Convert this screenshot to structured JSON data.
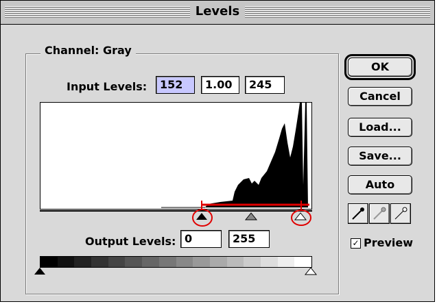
{
  "window": {
    "title": "Levels"
  },
  "channel": {
    "label": "Channel:",
    "value": "Gray"
  },
  "input_levels": {
    "label": "Input Levels:",
    "black": "152",
    "gamma": "1.00",
    "white": "245"
  },
  "output_levels": {
    "label": "Output Levels:",
    "black": "0",
    "white": "255"
  },
  "buttons": {
    "ok": "OK",
    "cancel": "Cancel",
    "load": "Load...",
    "save": "Save...",
    "auto": "Auto"
  },
  "preview": {
    "label": "Preview",
    "checked": true
  },
  "eyedroppers": [
    "black-point-eyedropper-icon",
    "gray-point-eyedropper-icon",
    "white-point-eyedropper-icon"
  ],
  "annotation": {
    "color": "#e00000"
  },
  "histogram_levels": {
    "min": 0,
    "max": 255,
    "input_black": 152,
    "input_gamma": 1.0,
    "input_white": 245
  }
}
